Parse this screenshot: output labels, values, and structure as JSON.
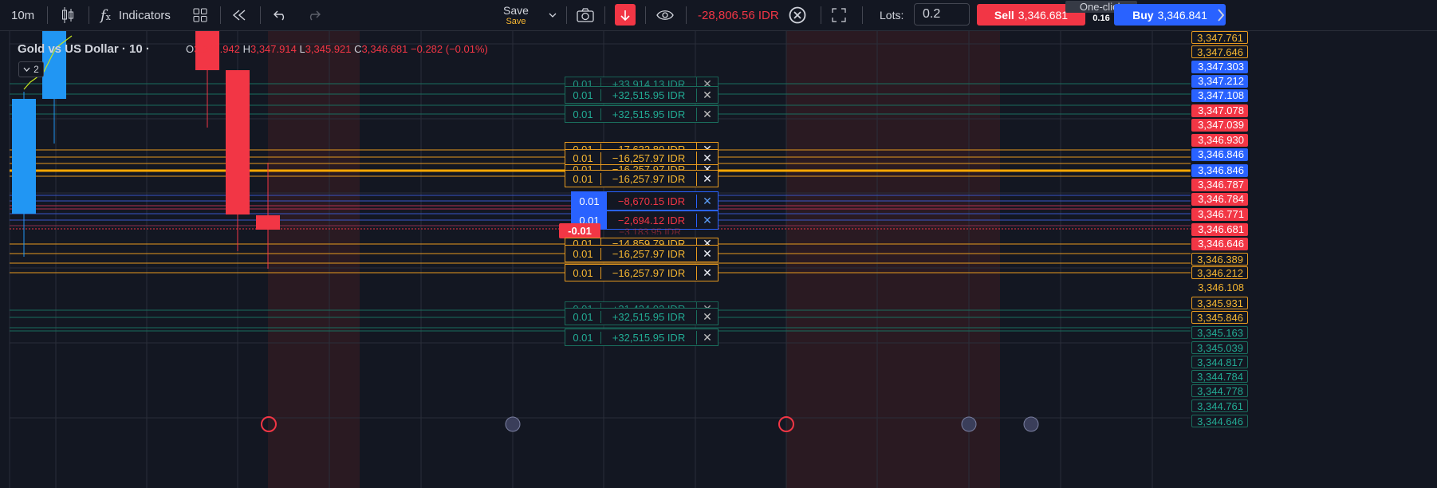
{
  "toolbar": {
    "interval": "10m",
    "indicators_label": "Indicators",
    "save_label": "Save",
    "save_sub_label": "Save",
    "pnl": "-28,806.56 IDR",
    "lots_label": "Lots:",
    "lots_value": "0.2",
    "sell_label": "Sell",
    "sell_price": "3,346.681",
    "buy_label": "Buy",
    "buy_price": "3,346.841",
    "oneclick_label": "One-click",
    "spread": "0.16"
  },
  "legend": {
    "symbol": "Gold vs US Dollar · 10 ·",
    "o_label": "O",
    "o_value": "3,346.942",
    "h_label": "H",
    "h_value": "3,347.914",
    "l_label": "L",
    "l_value": "3,345.921",
    "c_label": "C",
    "c_value": "3,346.681",
    "change": "−0.282 (−0.01%)",
    "collapse_count": "2"
  },
  "orders": {
    "tp_top": [
      {
        "qty": "0.01",
        "pl": "+33,914.13 IDR"
      },
      {
        "qty": "0.01",
        "pl": "+32,515.95 IDR"
      },
      {
        "qty": "0.01",
        "pl": "+32,515.95 IDR"
      }
    ],
    "sl": [
      {
        "qty": "0.01",
        "pl": "−17,632.80 IDR"
      },
      {
        "qty": "0.01",
        "pl": "−16,257.97 IDR"
      },
      {
        "qty": "0.01",
        "pl": "−16,257.97 IDR"
      },
      {
        "qty": "0.01",
        "pl": "−16,257.97 IDR"
      }
    ],
    "positions": [
      {
        "qty": "0.01",
        "pl": "−8,670.15 IDR"
      },
      {
        "qty": "0.01",
        "pl": "−2,694.12 IDR"
      }
    ],
    "pos_tag": "-0.01",
    "pos_ghost": "−3,183.95 IDR",
    "sl_lower": [
      {
        "qty": "0.01",
        "pl": "−14,859.79 IDR"
      },
      {
        "qty": "0.01",
        "pl": "−16,257.97 IDR"
      },
      {
        "qty": "0.01",
        "pl": "−16,257.97 IDR"
      }
    ],
    "tp_bottom": [
      {
        "qty": "0.01",
        "pl": "+31,424.03 IDR"
      },
      {
        "qty": "0.01",
        "pl": "+32,515.95 IDR"
      },
      {
        "qty": "0.01",
        "pl": "+32,515.95 IDR"
      }
    ],
    "close_glyph": "✕"
  },
  "price_scale": [
    {
      "price": "3,347.761",
      "style": "orange"
    },
    {
      "price": "3,347.646",
      "style": "orange"
    },
    {
      "price": "3,347.303",
      "style": "blue"
    },
    {
      "price": "3,347.212",
      "style": "blue"
    },
    {
      "price": "3,347.108",
      "style": "blue"
    },
    {
      "price": "3,347.078",
      "style": "red"
    },
    {
      "price": "3,347.039",
      "style": "red"
    },
    {
      "price": "3,346.930",
      "style": "red"
    },
    {
      "price": "3,346.846",
      "style": "blue"
    },
    {
      "price": "3,346.846",
      "style": "blue"
    },
    {
      "price": "3,346.787",
      "style": "red"
    },
    {
      "price": "3,346.784",
      "style": "red"
    },
    {
      "price": "3,346.771",
      "style": "red"
    },
    {
      "price": "3,346.681",
      "style": "red"
    },
    {
      "price": "3,346.646",
      "style": "red"
    },
    {
      "price": "3,346.389",
      "style": "orange"
    },
    {
      "price": "3,346.212",
      "style": "orange"
    },
    {
      "price": "3,346.108",
      "style": "plain"
    },
    {
      "price": "3,345.931",
      "style": "orange"
    },
    {
      "price": "3,345.846",
      "style": "orange"
    },
    {
      "price": "3,345.163",
      "style": "green"
    },
    {
      "price": "3,345.039",
      "style": "green"
    },
    {
      "price": "3,344.817",
      "style": "green"
    },
    {
      "price": "3,344.784",
      "style": "green"
    },
    {
      "price": "3,344.778",
      "style": "green"
    },
    {
      "price": "3,344.761",
      "style": "green"
    },
    {
      "price": "3,344.646",
      "style": "green"
    }
  ],
  "colors": {
    "up": "#2196f3",
    "down": "#f23645",
    "tp": "#22ab94",
    "sl": "#f7b731",
    "accent": "#2962ff",
    "background": "#131722"
  }
}
